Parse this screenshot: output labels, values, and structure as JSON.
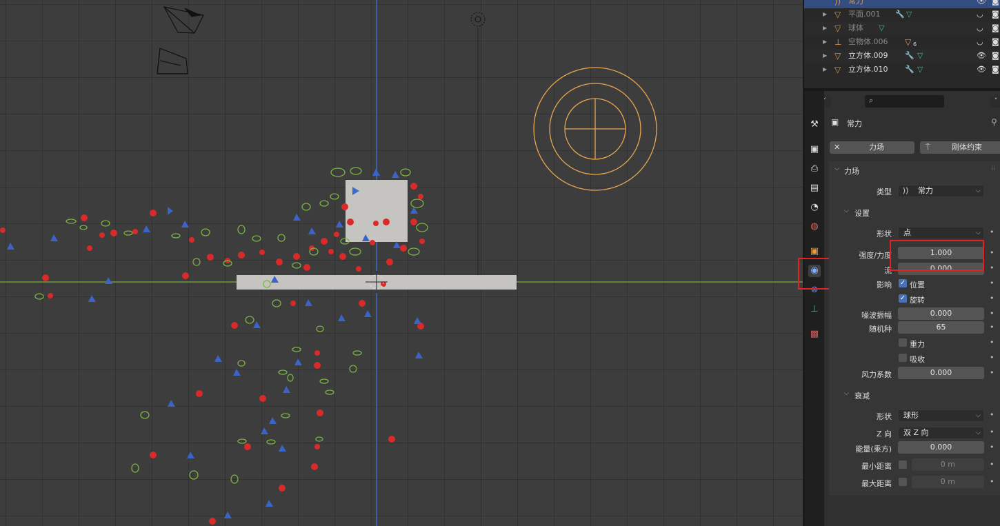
{
  "outliner": {
    "rows": [
      {
        "name": "常力",
        "selected": true
      },
      {
        "name": "平面.001"
      },
      {
        "name": "球体"
      },
      {
        "name": "空物体.006",
        "children_count": "6"
      },
      {
        "name": "立方体.009"
      },
      {
        "name": "立方体.010"
      }
    ]
  },
  "properties": {
    "search_placeholder": "",
    "object_name": "常力",
    "buttons": {
      "force_field": "力场",
      "rigid_constraint": "刚体约束"
    },
    "force_field_section": "力场",
    "type_label": "类型",
    "type_value": "常力",
    "settings": {
      "title": "设置",
      "shape_label": "形状",
      "shape_value": "点",
      "strength_label": "强度/力度",
      "strength_value": "1.000",
      "flow_label": "流",
      "flow_value": "0.000",
      "affect_label": "影响",
      "location_label": "位置",
      "rotation_label": "旋转",
      "noise_label": "噪波振幅",
      "noise_value": "0.000",
      "seed_label": "随机种",
      "seed_value": "65",
      "gravity_label": "重力",
      "absorb_label": "吸收",
      "wind_label": "风力系数",
      "wind_value": "0.000"
    },
    "falloff": {
      "title": "衰减",
      "shape_label": "形状",
      "shape_value": "球形",
      "z_label": "Z 向",
      "z_value": "双 Z 向",
      "power_label": "能量(乘方)",
      "power_value": "0.000",
      "min_label": "最小距离",
      "min_value": "0 m",
      "max_label": "最大距离",
      "max_value": "0 m"
    }
  },
  "colors": {
    "accent_select": "#334d80",
    "highlight_box": "#e02424",
    "object_orange": "#e69a42",
    "axis_green": "#6e9a3a",
    "axis_blue": "#3b6cc8"
  }
}
